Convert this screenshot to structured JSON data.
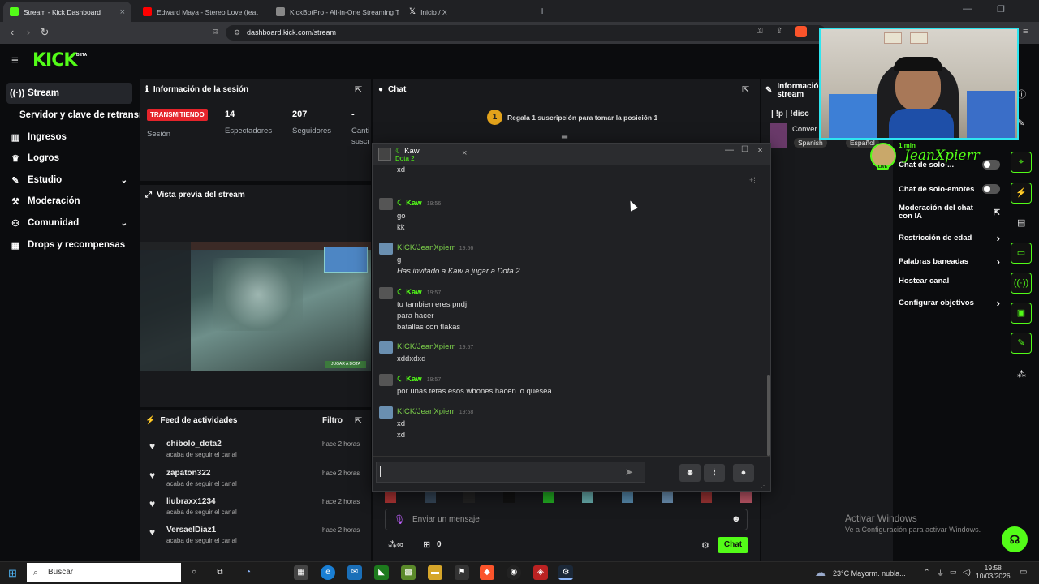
{
  "browser": {
    "tabs": [
      {
        "title": "Stream - Kick Dashboard",
        "color": "#53fc18"
      },
      {
        "title": "Edward Maya - Stereo Love (feat",
        "color": "#ff0000"
      },
      {
        "title": "KickBotPro - All-in-One Streaming To",
        "color": "#888888"
      },
      {
        "title": "Inicio / X",
        "color": "#ffffff"
      }
    ],
    "url": "dashboard.kick.com/stream"
  },
  "brand": {
    "logo": "KICK",
    "badge": "BETA",
    "accent": "#53fc18"
  },
  "sidebar": {
    "items": [
      {
        "label": "Stream",
        "icon": "broadcast-icon"
      },
      {
        "label": "Servidor y clave de retransm",
        "icon": ""
      },
      {
        "label": "Ingresos",
        "icon": "chart-icon"
      },
      {
        "label": "Logros",
        "icon": "trophy-icon"
      },
      {
        "label": "Estudio",
        "icon": "wrench-icon"
      },
      {
        "label": "Moderación",
        "icon": "hammer-icon"
      },
      {
        "label": "Comunidad",
        "icon": "users-icon"
      },
      {
        "label": "Drops y recompensas",
        "icon": "gift-icon"
      }
    ]
  },
  "session": {
    "title": "Información de la sesión",
    "status": "TRANSMITIENDO",
    "status_label": "Sesión",
    "viewers": "14",
    "viewers_label": "Espectadores",
    "followers": "207",
    "followers_label": "Seguidores",
    "extra": "-",
    "extra_label": "Canti",
    "extra_label2": "suscr"
  },
  "preview": {
    "title": "Vista previa del stream",
    "button": "JUGAR A DOTA"
  },
  "feed": {
    "title": "Feed de actividades",
    "filter": "Filtro",
    "items": [
      {
        "user": "chibolo_dota2",
        "action": "acaba de seguir el canal",
        "time": "hace 2 horas"
      },
      {
        "user": "zapaton322",
        "action": "acaba de seguir el canal",
        "time": "hace 2 horas"
      },
      {
        "user": "liubraxx1234",
        "action": "acaba de seguir el canal",
        "time": "hace 2 horas"
      },
      {
        "user": "VersaelDiaz1",
        "action": "acaba de seguir el canal",
        "time": "hace 2 horas"
      }
    ]
  },
  "chat": {
    "title": "Chat",
    "gift_rank": "1",
    "gift_text": "Regala 1 suscripción para tomar la posición 1",
    "placeholder": "Enviar un mensaje",
    "send_label": "Chat",
    "points": "0"
  },
  "popup": {
    "user": "Kaw",
    "game": "Dota 2",
    "top_fragment": "xd",
    "messages": [
      {
        "user": "Kaw",
        "time": "19:56",
        "color": "#53fc18",
        "lines": [
          "go",
          "kk"
        ]
      },
      {
        "user": "KICK/JeanXpierr",
        "time": "19:56",
        "color": "#7ccf4a",
        "lines": [
          "g"
        ],
        "system": "Has invitado a  Kaw a jugar a  Dota 2"
      },
      {
        "user": "Kaw",
        "time": "19:57",
        "color": "#53fc18",
        "lines": [
          "tu tambien eres pndj",
          "para hacer",
          "batallas con flakas"
        ]
      },
      {
        "user": "KICK/JeanXpierr",
        "time": "19:57",
        "color": "#7ccf4a",
        "lines": [
          "xddxdxd"
        ]
      },
      {
        "user": "Kaw",
        "time": "19:57",
        "color": "#53fc18",
        "lines": [
          "por unas tetas esos wbones hacen lo quesea"
        ]
      },
      {
        "user": "KICK/JeanXpierr",
        "time": "19:58",
        "color": "#7ccf4a",
        "lines": [
          "xd",
          "xd"
        ]
      }
    ]
  },
  "stream_info": {
    "title": "Información stream",
    "title_line2": "stream",
    "tags_line": "| !p | !disc",
    "conv": "Conver",
    "lang1": "Spanish",
    "lang2": "Español"
  },
  "webcam": {
    "name": "JeanXpierr",
    "uptime": "1 min",
    "live": "LIVE"
  },
  "settings": [
    {
      "label": "Chat de solo-...",
      "type": "toggle"
    },
    {
      "label": "Chat de solo-emotes",
      "type": "toggle"
    },
    {
      "label": "Moderación del chat con IA",
      "type": "link"
    },
    {
      "label": "Restricción de edad",
      "type": "chevron"
    },
    {
      "label": "Palabras baneadas",
      "type": "chevron"
    },
    {
      "label": "Hostear canal",
      "type": "none"
    },
    {
      "label": "Configurar objetivos",
      "type": "chevron"
    }
  ],
  "watermark": {
    "line1": "Activar Windows",
    "line2": "Ve a Configuración para activar Windows."
  },
  "taskbar": {
    "search": "Buscar",
    "weather": "23°C  Mayorm. nubla...",
    "time": "19:58",
    "date": "10/03/2026"
  }
}
